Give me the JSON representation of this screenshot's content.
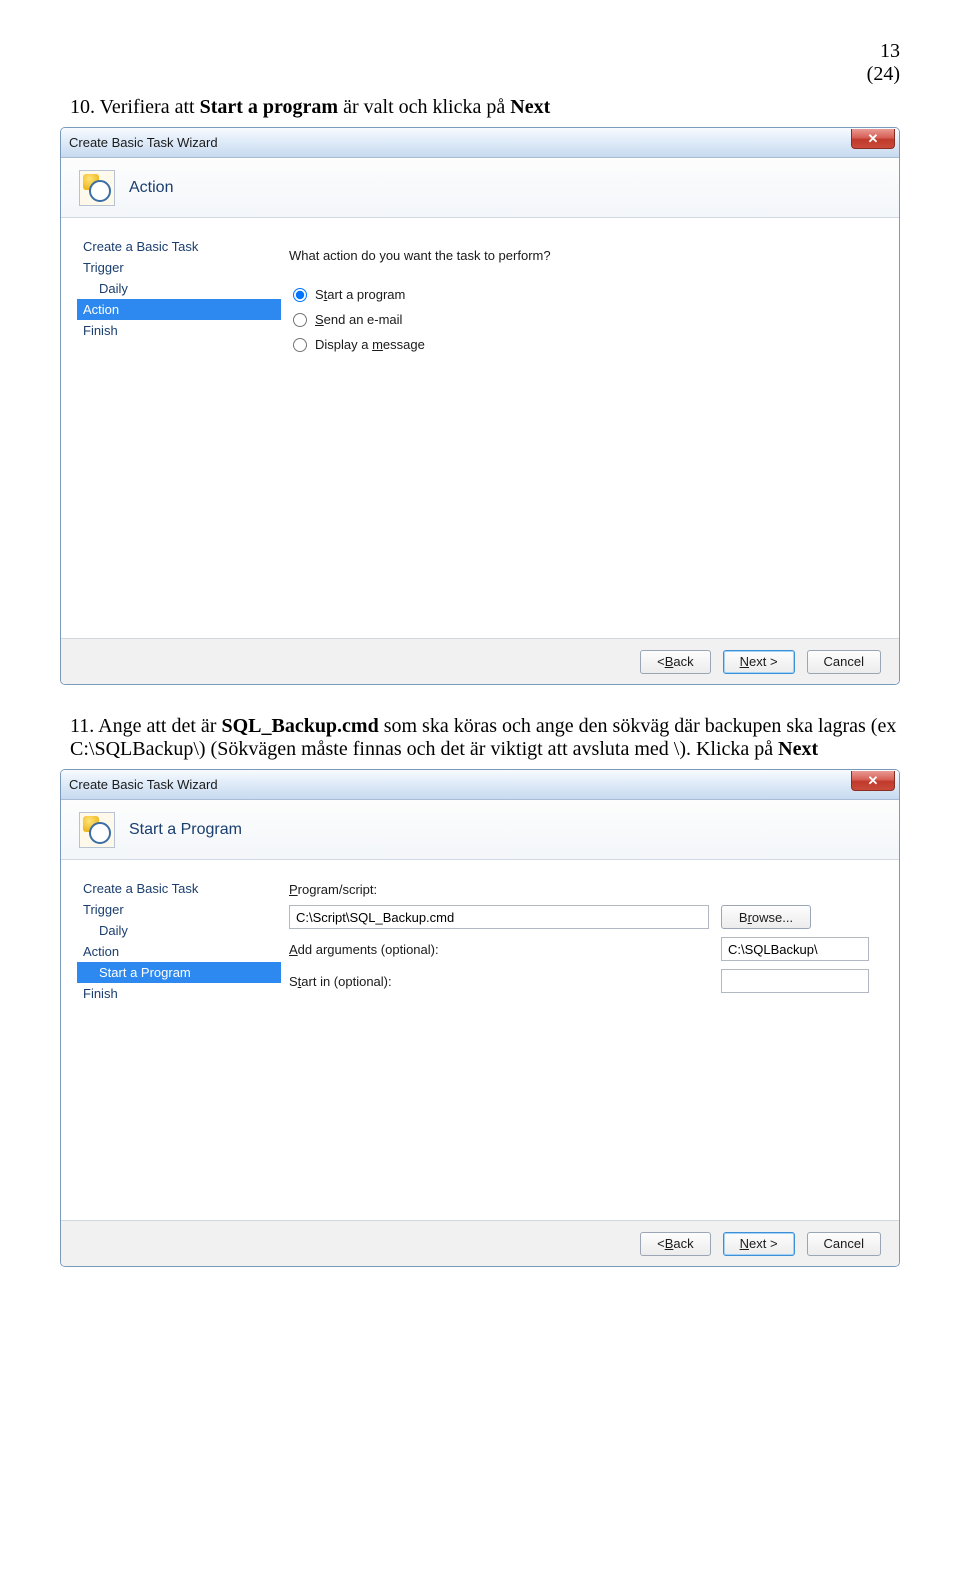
{
  "page": {
    "num": "13",
    "of": "(24)"
  },
  "instr1": {
    "n": "10.",
    "pre": "Verifiera att ",
    "bold1": "Start a program",
    "mid": " är valt och klicka på ",
    "bold2": "Next"
  },
  "instr2": {
    "n": "11.",
    "pre": "Ange att det är ",
    "bold1": "SQL_Backup.cmd",
    "mid1": " som ska köras och ange den sökväg där backupen ska lagras (ex C:\\SQLBackup\\) (Sökvägen måste finnas och det är viktigt att avsluta med \\). Klicka på ",
    "bold2": "Next"
  },
  "wiz1": {
    "title": "Create Basic Task Wizard",
    "header": "Action",
    "side": {
      "create": "Create a Basic Task",
      "trigger": "Trigger",
      "daily": "Daily",
      "action": "Action",
      "finish": "Finish"
    },
    "question": "What action do you want the task to perform?",
    "opt1": {
      "u": "t",
      "pre": "S",
      "post": "art a program"
    },
    "opt2": {
      "u": "S",
      "post": "end an e-mail"
    },
    "opt3": {
      "u": "m",
      "pre": "Display a ",
      "post": "essage"
    },
    "btn_back": {
      "u": "B",
      "pre": "< ",
      "post": "ack"
    },
    "btn_next": {
      "u": "N",
      "post": "ext >"
    },
    "btn_cancel": "Cancel"
  },
  "wiz2": {
    "title": "Create Basic Task Wizard",
    "header": "Start a Program",
    "side": {
      "create": "Create a Basic Task",
      "trigger": "Trigger",
      "daily": "Daily",
      "action": "Action",
      "start": "Start a Program",
      "finish": "Finish"
    },
    "labels": {
      "program": {
        "u": "P",
        "post": "rogram/script:"
      },
      "args": {
        "u": "A",
        "post": "dd arguments (optional):"
      },
      "startin": {
        "u": "t",
        "pre": "S",
        "post": "art in (optional):"
      },
      "browse": {
        "u": "r",
        "pre": "B",
        "post": "owse..."
      }
    },
    "values": {
      "program": "C:\\Script\\SQL_Backup.cmd",
      "args": "C:\\SQLBackup\\",
      "startin": ""
    },
    "btn_back": {
      "u": "B",
      "pre": "< ",
      "post": "ack"
    },
    "btn_next": {
      "u": "N",
      "post": "ext >"
    },
    "btn_cancel": "Cancel"
  }
}
